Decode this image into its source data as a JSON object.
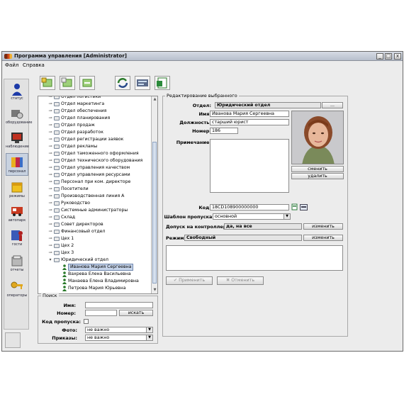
{
  "window": {
    "title": "Программа управления [Administrator]",
    "buttons": {
      "minimize": "_",
      "maximize": "□",
      "close": "x"
    }
  },
  "menu": {
    "file": "Файл",
    "help": "Справка"
  },
  "nav": [
    {
      "label": "статус",
      "icon": "person-icon"
    },
    {
      "label": "оборудование",
      "icon": "equipment-icon"
    },
    {
      "label": "наблюдение",
      "icon": "monitor-icon"
    },
    {
      "label": "персонал",
      "icon": "staff-icon"
    },
    {
      "label": "режимы",
      "icon": "modes-icon"
    },
    {
      "label": "автопарк",
      "icon": "vehicle-icon"
    },
    {
      "label": "гости",
      "icon": "guest-icon"
    },
    {
      "label": "отчеты",
      "icon": "reports-icon"
    },
    {
      "label": "операторы",
      "icon": "operators-icon"
    }
  ],
  "toolbar": {
    "icons": [
      "add-folder-icon",
      "add-user-icon",
      "remove-icon",
      "refresh-icon",
      "card-reader-icon",
      "export-excel-icon"
    ]
  },
  "tree": {
    "items": [
      {
        "label": "Отдел логистики",
        "type": "folder",
        "level": 1
      },
      {
        "label": "Отдел маркетинга",
        "type": "folder",
        "level": 1
      },
      {
        "label": "Отдел обеспечения",
        "type": "folder",
        "level": 1
      },
      {
        "label": "Отдел планирования",
        "type": "folder",
        "level": 1
      },
      {
        "label": "Отдел продаж",
        "type": "folder",
        "level": 1
      },
      {
        "label": "Отдел разработок",
        "type": "folder",
        "level": 1
      },
      {
        "label": "Отдел регистрации заявок",
        "type": "folder",
        "level": 1
      },
      {
        "label": "Отдел рекламы",
        "type": "folder",
        "level": 1
      },
      {
        "label": "Отдел таможенного оформления",
        "type": "folder",
        "level": 1
      },
      {
        "label": "Отдел технического оборудования",
        "type": "folder",
        "level": 1
      },
      {
        "label": "Отдел управления качеством",
        "type": "folder",
        "level": 1
      },
      {
        "label": "Отдел управления ресурсами",
        "type": "folder",
        "level": 1
      },
      {
        "label": "Персонал при ком. директоре",
        "type": "folder",
        "level": 1
      },
      {
        "label": "Посетители",
        "type": "folder",
        "level": 1
      },
      {
        "label": "Производственная линия А",
        "type": "folder",
        "level": 1
      },
      {
        "label": "Руководство",
        "type": "folder",
        "level": 1
      },
      {
        "label": "Системные администраторы",
        "type": "folder",
        "level": 1
      },
      {
        "label": "Склад",
        "type": "folder",
        "level": 1
      },
      {
        "label": "Совет директоров",
        "type": "folder",
        "level": 1
      },
      {
        "label": "Финансовый отдел",
        "type": "folder",
        "level": 1
      },
      {
        "label": "Цех 1",
        "type": "folder",
        "level": 1
      },
      {
        "label": "Цех 2",
        "type": "folder",
        "level": 1
      },
      {
        "label": "Цех 3",
        "type": "folder",
        "level": 1
      },
      {
        "label": "Юридический отдел",
        "type": "folder-open",
        "level": 1
      },
      {
        "label": "Иванова Мария Сергеевна",
        "type": "person",
        "level": 2,
        "selected": true
      },
      {
        "label": "Вахрева Елена Васильевна",
        "type": "person",
        "level": 2
      },
      {
        "label": "Манаева Елена Владимировна",
        "type": "person",
        "level": 2
      },
      {
        "label": "Петрова Мария Юрьевна",
        "type": "person",
        "level": 2
      }
    ]
  },
  "search": {
    "title": "Поиск",
    "name_label": "Имя:",
    "name_value": "",
    "number_label": "Номер:",
    "number_value": "",
    "search_button": "искать",
    "pass_code_label": "Код пропуска:",
    "photo_label": "Фото:",
    "photo_value": "не важно",
    "orders_label": "Приказы:",
    "orders_value": "не важно"
  },
  "edit": {
    "title": "Редактирование выбранного",
    "dept_label": "Отдел:",
    "dept_value": "Юридический отдел",
    "dept_button": "...",
    "name_label": "Имя:",
    "name_value": "Иванова Мария Сергеевна",
    "position_label": "Должность:",
    "position_value": "старший юрист",
    "number_label": "Номер:",
    "number_value": "186",
    "note_label": "Примечание:",
    "note_value": "",
    "photo_change": "сменить",
    "photo_delete": "удалить",
    "code_label": "Код:",
    "code_value": "18CD108900000000",
    "template_label": "Шаблон пропуска:",
    "template_value": "основной",
    "access_label": "Допуск на контроллеры:",
    "access_value": "да, на все",
    "access_button": "изменить",
    "mode_label": "Режим:",
    "mode_value": "Свободный",
    "mode_button": "изменить",
    "apply_button": "Применить",
    "cancel_button": "Отменить"
  }
}
